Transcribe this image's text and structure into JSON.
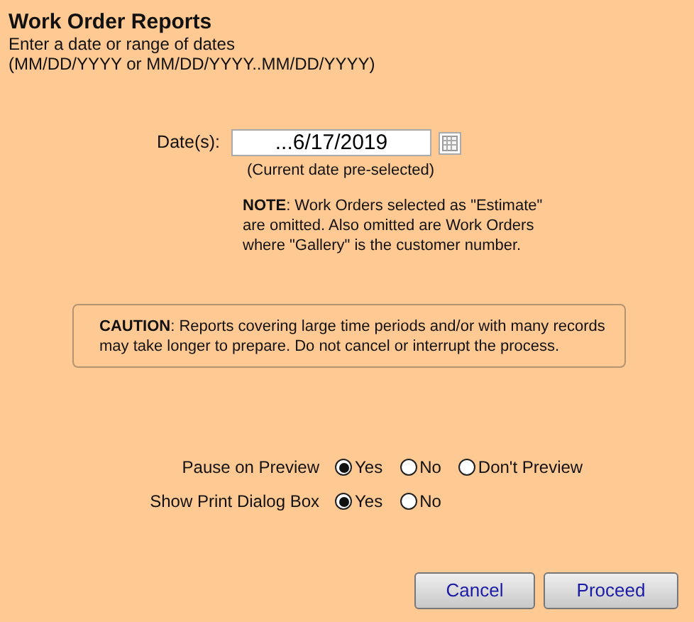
{
  "title": "Work Order Reports",
  "instructions": [
    "Enter a date or range of dates",
    "(MM/DD/YYYY or MM/DD/YYYY..MM/DD/YYYY)"
  ],
  "date_field": {
    "label": "Date(s):",
    "value": "...6/17/2019",
    "hint": "(Current date pre-selected)"
  },
  "note": [
    "**NOTE**: Work Orders selected as \"Estimate\"",
    "are omitted. Also omitted are Work Orders",
    "where \"Gallery\" is the customer number."
  ],
  "caution": [
    "**CAUTION**: Reports covering large time periods and/or with many records",
    "may take longer to prepare. Do not cancel or interrupt the process."
  ],
  "options": [
    {
      "label": "Pause on Preview",
      "choices": [
        {
          "label": "Yes",
          "selected": true
        },
        {
          "label": "No",
          "selected": false
        },
        {
          "label": "Don't Preview",
          "selected": false
        }
      ]
    },
    {
      "label": "Show Print Dialog Box",
      "choices": [
        {
          "label": "Yes",
          "selected": true
        },
        {
          "label": "No",
          "selected": false
        }
      ]
    }
  ],
  "buttons": [
    "Cancel",
    "Proceed"
  ]
}
